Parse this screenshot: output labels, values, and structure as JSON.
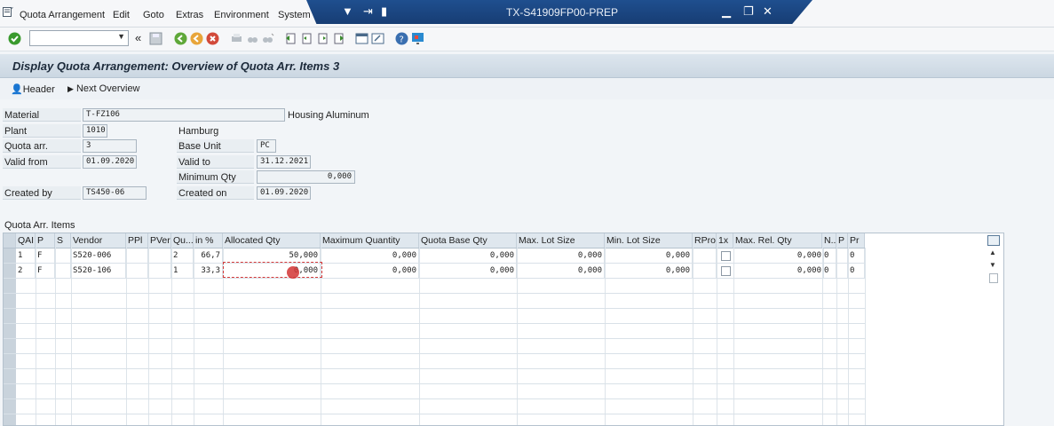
{
  "menu": {
    "items": [
      "Quota Arrangement",
      "Edit",
      "Goto",
      "Extras",
      "Environment",
      "System"
    ]
  },
  "window": {
    "title": "TX-S41909FP00-PREP"
  },
  "toolbar": {
    "command_field_value": ""
  },
  "page": {
    "title": "Display Quota Arrangement: Overview of Quota Arr. Items 3"
  },
  "app_toolbar": {
    "header_label": "Header",
    "next_overview_label": "Next Overview"
  },
  "form": {
    "material_label": "Material",
    "material_value": "T-FZ106",
    "material_desc": "Housing Aluminum",
    "plant_label": "Plant",
    "plant_value": "1010",
    "plant_name": "Hamburg",
    "quota_label": "Quota arr.",
    "quota_value": "3",
    "base_unit_label": "Base Unit",
    "base_unit_value": "PC",
    "valid_from_label": "Valid from",
    "valid_from_value": "01.09.2020",
    "valid_to_label": "Valid to",
    "valid_to_value": "31.12.2021",
    "min_qty_label": "Minimum Qty",
    "min_qty_value": "0,000",
    "created_by_label": "Created by",
    "created_by_value": "TS450-06",
    "created_on_label": "Created on",
    "created_on_value": "01.09.2020"
  },
  "table": {
    "section_title": "Quota Arr. Items",
    "columns": [
      "QAI",
      "P",
      "S",
      "Vendor",
      "PPl",
      "PVer",
      "Qu...",
      "in %",
      "Allocated Qty",
      "Maximum Quantity",
      "Quota Base Qty",
      "Max. Lot Size",
      "Min. Lot Size",
      "RPro",
      "1x",
      "Max. Rel. Qty",
      "N..",
      "P",
      "Pr"
    ],
    "rows": [
      {
        "qai": "1",
        "p": "F",
        "s": "",
        "vendor": "S520-006",
        "ppl": "",
        "pver": "",
        "qu": "2",
        "pct": "66,7",
        "alloc": "50,000",
        "maxq": "0,000",
        "qbase": "0,000",
        "maxlot": "0,000",
        "minlot": "0,000",
        "rpro": "",
        "maxrel": "0,000",
        "n": "0",
        "p2": "",
        "pr": "0"
      },
      {
        "qai": "2",
        "p": "F",
        "s": "",
        "vendor": "S520-106",
        "ppl": "",
        "pver": "",
        "qu": "1",
        "pct": "33,3",
        "alloc": "0,000",
        "maxq": "0,000",
        "qbase": "0,000",
        "maxlot": "0,000",
        "minlot": "0,000",
        "rpro": "",
        "maxrel": "0,000",
        "n": "0",
        "p2": "",
        "pr": "0"
      }
    ]
  },
  "colors": {
    "title_bar": "#1f4f8f",
    "accent_green": "#3a9a2e",
    "focus_red": "#d43b3b"
  }
}
